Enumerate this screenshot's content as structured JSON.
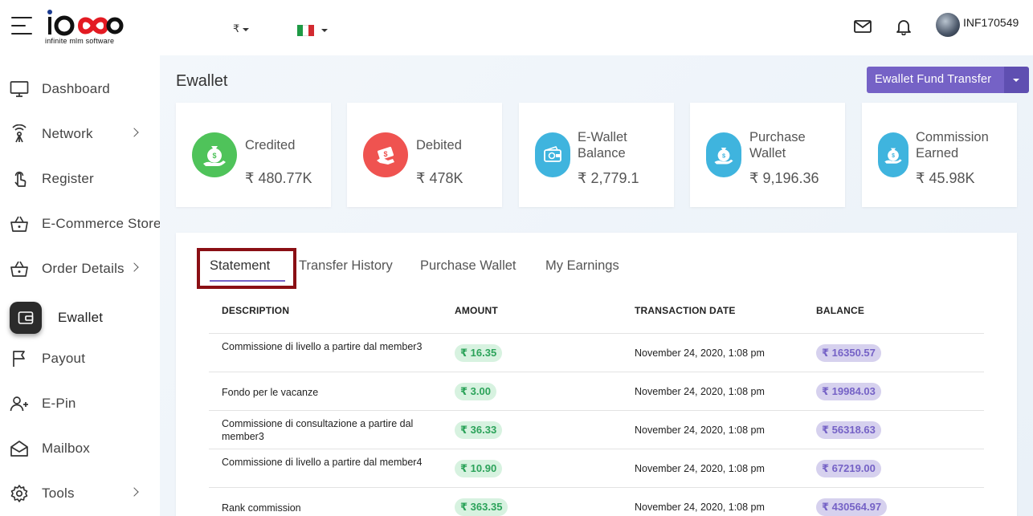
{
  "header": {
    "logo_brand": "iOSS",
    "logo_tagline": "infinite mlm software",
    "currency_symbol": "₹",
    "username": "INF170549"
  },
  "sidebar": {
    "items": [
      {
        "label": "Dashboard",
        "icon": "monitor-icon"
      },
      {
        "label": "Network",
        "icon": "network-icon"
      },
      {
        "label": "Register",
        "icon": "touch-icon"
      },
      {
        "label": "E-Commerce Store",
        "icon": "basket-icon"
      },
      {
        "label": "Order Details",
        "icon": "basket-icon"
      },
      {
        "label": "Ewallet",
        "icon": "wallet-icon"
      },
      {
        "label": "Payout",
        "icon": "flag-icon"
      },
      {
        "label": "E-Pin",
        "icon": "user-plus-icon"
      },
      {
        "label": "Mailbox",
        "icon": "envelope-icon"
      },
      {
        "label": "Tools",
        "icon": "gear-icon"
      }
    ]
  },
  "page": {
    "title": "Ewallet",
    "fund_transfer_label": "Ewallet Fund Transfer"
  },
  "stats": [
    {
      "label": "Credited",
      "value": "₹ 480.77K",
      "color": "#4fc35a",
      "icon": "money-bag-hand-icon"
    },
    {
      "label": "Debited",
      "value": "₹ 478K",
      "color": "#ef5350",
      "icon": "money-out-icon"
    },
    {
      "label": "E-Wallet Balance",
      "value": "₹ 2,779.1",
      "color": "#3fb4de",
      "icon": "wallet-money-icon"
    },
    {
      "label": "Purchase Wallet",
      "value": "₹ 9,196.36",
      "color": "#3fb4de",
      "icon": "money-bag-hand-icon"
    },
    {
      "label": "Commission Earned",
      "value": "₹ 45.98K",
      "color": "#3fb4de",
      "icon": "money-bag-hand-icon"
    }
  ],
  "tabs": [
    "Statement",
    "Transfer History",
    "Purchase Wallet",
    "My Earnings"
  ],
  "table": {
    "headers": [
      "DESCRIPTION",
      "AMOUNT",
      "TRANSACTION DATE",
      "BALANCE"
    ],
    "rows": [
      {
        "description": "Commissione di livello a partire dal member3",
        "amount": "₹ 16.35",
        "date": "November 24, 2020, 1:08 pm",
        "balance": "₹ 16350.57"
      },
      {
        "description": "Fondo per le vacanze",
        "amount": "₹ 3.00",
        "date": "November 24, 2020, 1:08 pm",
        "balance": "₹ 19984.03"
      },
      {
        "description": "Commissione di consultazione a partire dal member3",
        "amount": "₹ 36.33",
        "date": "November 24, 2020, 1:08 pm",
        "balance": "₹ 56318.63"
      },
      {
        "description": "Commissione di livello a partire dal member4",
        "amount": "₹ 10.90",
        "date": "November 24, 2020, 1:08 pm",
        "balance": "₹ 67219.00"
      },
      {
        "description": "Rank commission",
        "amount": "₹ 363.35",
        "date": "November 24, 2020, 1:08 pm",
        "balance": "₹ 430564.97"
      }
    ]
  }
}
